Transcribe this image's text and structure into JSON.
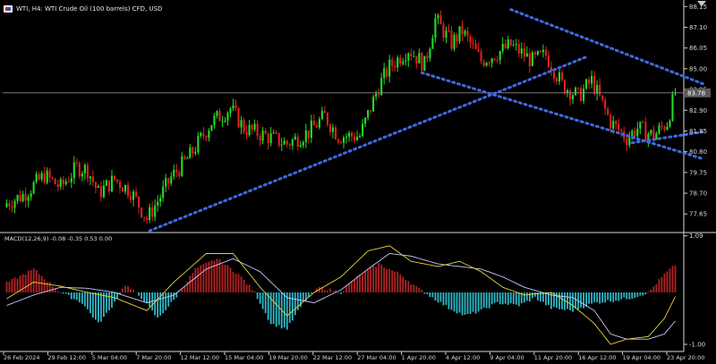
{
  "header": {
    "symbol_icon": "flag-icon",
    "title": "WTI, H4:  WTI Crude Oil (100 barrels) CFD, USD"
  },
  "macd_header": {
    "label": "MACD(12,26,9) -0.08 -0.35 0.53 0.00"
  },
  "colors": {
    "background": "#000000",
    "grid_line": "#ffffff",
    "bull_candle": "#22dd22",
    "bear_candle": "#e02020",
    "trendline": "#4169e1",
    "current_price_line": "#8a8a8a",
    "price_tag_bg": "#5a5a5a",
    "macd_pos": "#b22222",
    "macd_neg": "#2eb7c8",
    "macd_line": "#e8d23a",
    "signal_line": "#c8c8ff"
  },
  "chart_data": [
    {
      "type": "candlestick",
      "title": "WTI, H4:  WTI Crude Oil (100 barrels) CFD, USD",
      "y_axis_ticks": [
        "88.15",
        "87.10",
        "86.05",
        "85.00",
        "83.95",
        "82.90",
        "81.85",
        "80.80",
        "79.75",
        "78.70",
        "77.65"
      ],
      "ylim": [
        76.8,
        88.3
      ],
      "x_tick_labels": [
        "26 Feb 2024",
        "29 Feb 12:00",
        "5 Mar 04:00",
        "7 Mar 20:00",
        "12 Mar 12:00",
        "15 Mar 04:00",
        "19 Mar 20:00",
        "22 Mar 12:00",
        "27 Mar 04:00",
        "1 Apr 20:00",
        "4 Apr 12:00",
        "9 Apr 04:00",
        "11 Apr 20:00",
        "16 Apr 12:00",
        "19 Apr 04:00",
        "23 Apr 20:00"
      ],
      "current_price": "83.78",
      "anchor_closes": [
        [
          0,
          78.2
        ],
        [
          6,
          78.6
        ],
        [
          14,
          79.6
        ],
        [
          20,
          79.0
        ],
        [
          26,
          80.0
        ],
        [
          30,
          79.9
        ],
        [
          34,
          78.7
        ],
        [
          40,
          79.4
        ],
        [
          46,
          78.8
        ],
        [
          52,
          77.4
        ],
        [
          56,
          78.3
        ],
        [
          61,
          79.5
        ],
        [
          68,
          80.6
        ],
        [
          76,
          82.3
        ],
        [
          83,
          83.0
        ],
        [
          88,
          82.0
        ],
        [
          96,
          81.6
        ],
        [
          104,
          81.2
        ],
        [
          112,
          81.8
        ],
        [
          118,
          82.6
        ],
        [
          123,
          81.6
        ],
        [
          131,
          81.6
        ],
        [
          138,
          84.1
        ],
        [
          142,
          85.1
        ],
        [
          149,
          86.0
        ],
        [
          155,
          85.2
        ],
        [
          159,
          87.5
        ],
        [
          165,
          86.3
        ],
        [
          169,
          86.9
        ],
        [
          176,
          85.4
        ],
        [
          182,
          85.8
        ],
        [
          187,
          86.2
        ],
        [
          195,
          85.4
        ],
        [
          200,
          85.7
        ],
        [
          206,
          84.2
        ],
        [
          212,
          83.6
        ],
        [
          217,
          84.4
        ],
        [
          224,
          82.3
        ],
        [
          230,
          81.5
        ],
        [
          234,
          82.0
        ],
        [
          240,
          81.6
        ],
        [
          245,
          82.3
        ],
        [
          248,
          83.8
        ]
      ],
      "trendlines": [
        {
          "name": "ascending-support",
          "from": [
            53,
            76.8
          ],
          "to": [
            215,
            85.6
          ]
        },
        {
          "name": "channel-upper",
          "from": [
            187,
            88.0
          ],
          "to": [
            259,
            84.2
          ]
        },
        {
          "name": "channel-lower",
          "from": [
            154,
            84.8
          ],
          "to": [
            258,
            80.45
          ]
        },
        {
          "name": "apr-19-support",
          "from": [
            232,
            81.25
          ],
          "to": [
            258,
            81.8
          ]
        }
      ]
    },
    {
      "type": "macd",
      "label": "MACD(12,26,9) -0.08 -0.35 0.53 0.00",
      "y_axis_ticks": [
        "1.09",
        "-1.00"
      ],
      "ylim": [
        -1.12,
        1.12
      ],
      "histogram_anchors": [
        [
          0,
          0.18
        ],
        [
          10,
          0.45
        ],
        [
          20,
          0.0
        ],
        [
          28,
          -0.2
        ],
        [
          34,
          -0.6
        ],
        [
          38,
          -0.35
        ],
        [
          44,
          0.15
        ],
        [
          50,
          -0.1
        ],
        [
          56,
          -0.5
        ],
        [
          62,
          -0.15
        ],
        [
          70,
          0.45
        ],
        [
          78,
          0.65
        ],
        [
          86,
          0.35
        ],
        [
          92,
          0.0
        ],
        [
          98,
          -0.6
        ],
        [
          104,
          -0.7
        ],
        [
          110,
          -0.2
        ],
        [
          116,
          0.1
        ],
        [
          124,
          0.0
        ],
        [
          130,
          0.3
        ],
        [
          138,
          0.55
        ],
        [
          146,
          0.35
        ],
        [
          152,
          0.1
        ],
        [
          158,
          -0.1
        ],
        [
          164,
          -0.3
        ],
        [
          170,
          -0.45
        ],
        [
          176,
          -0.35
        ],
        [
          182,
          -0.2
        ],
        [
          190,
          -0.25
        ],
        [
          196,
          -0.1
        ],
        [
          202,
          -0.3
        ],
        [
          210,
          -0.35
        ],
        [
          218,
          -0.2
        ],
        [
          226,
          -0.15
        ],
        [
          232,
          -0.1
        ],
        [
          238,
          0.0
        ],
        [
          244,
          0.35
        ],
        [
          248,
          0.53
        ]
      ],
      "macd_anchors": [
        [
          0,
          -0.12
        ],
        [
          10,
          0.2
        ],
        [
          20,
          0.12
        ],
        [
          30,
          0.0
        ],
        [
          40,
          -0.1
        ],
        [
          52,
          -0.35
        ],
        [
          62,
          0.2
        ],
        [
          74,
          0.75
        ],
        [
          84,
          0.75
        ],
        [
          94,
          0.1
        ],
        [
          104,
          -0.45
        ],
        [
          114,
          0.0
        ],
        [
          124,
          0.3
        ],
        [
          134,
          0.8
        ],
        [
          142,
          0.9
        ],
        [
          150,
          0.6
        ],
        [
          160,
          0.5
        ],
        [
          168,
          0.6
        ],
        [
          176,
          0.4
        ],
        [
          184,
          0.1
        ],
        [
          192,
          -0.05
        ],
        [
          202,
          0.0
        ],
        [
          210,
          -0.25
        ],
        [
          218,
          -0.6
        ],
        [
          224,
          -1.0
        ],
        [
          230,
          -0.9
        ],
        [
          238,
          -0.85
        ],
        [
          244,
          -0.5
        ],
        [
          248,
          -0.08
        ]
      ],
      "signal_anchors": [
        [
          0,
          -0.25
        ],
        [
          10,
          -0.05
        ],
        [
          20,
          0.1
        ],
        [
          30,
          0.08
        ],
        [
          40,
          0.0
        ],
        [
          52,
          -0.2
        ],
        [
          62,
          -0.05
        ],
        [
          74,
          0.45
        ],
        [
          84,
          0.65
        ],
        [
          94,
          0.4
        ],
        [
          104,
          -0.1
        ],
        [
          114,
          -0.2
        ],
        [
          124,
          0.05
        ],
        [
          134,
          0.45
        ],
        [
          142,
          0.75
        ],
        [
          150,
          0.7
        ],
        [
          160,
          0.55
        ],
        [
          168,
          0.5
        ],
        [
          176,
          0.45
        ],
        [
          184,
          0.3
        ],
        [
          192,
          0.1
        ],
        [
          202,
          -0.05
        ],
        [
          210,
          -0.1
        ],
        [
          218,
          -0.35
        ],
        [
          224,
          -0.8
        ],
        [
          230,
          -0.9
        ],
        [
          238,
          -0.9
        ],
        [
          244,
          -0.8
        ],
        [
          248,
          -0.55
        ]
      ]
    }
  ]
}
